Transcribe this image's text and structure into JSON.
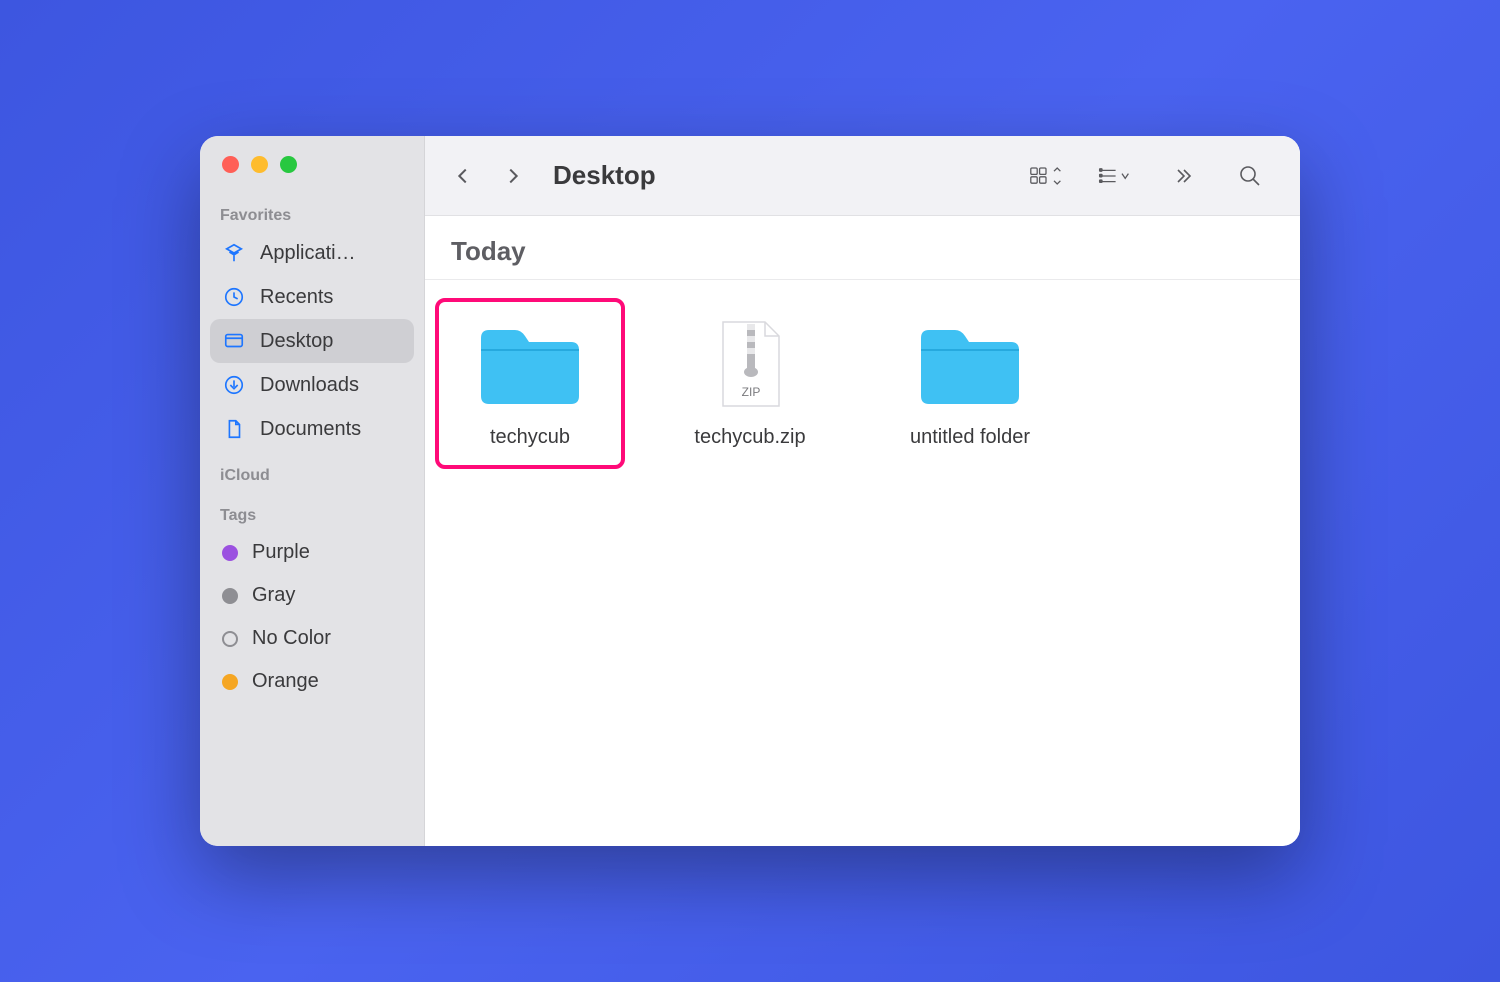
{
  "sidebar": {
    "groups": {
      "favorites": {
        "label": "Favorites",
        "items": [
          {
            "icon": "applications",
            "label": "Applicati…"
          },
          {
            "icon": "recents",
            "label": "Recents"
          },
          {
            "icon": "desktop",
            "label": "Desktop",
            "active": true
          },
          {
            "icon": "downloads",
            "label": "Downloads"
          },
          {
            "icon": "documents",
            "label": "Documents"
          }
        ]
      },
      "icloud": {
        "label": "iCloud"
      },
      "tags": {
        "label": "Tags",
        "items": [
          {
            "color": "purple",
            "label": "Purple"
          },
          {
            "color": "gray",
            "label": "Gray"
          },
          {
            "color": "nocolor",
            "label": "No Color"
          },
          {
            "color": "orange",
            "label": "Orange"
          }
        ]
      }
    }
  },
  "toolbar": {
    "title": "Desktop"
  },
  "section": {
    "heading": "Today"
  },
  "files": [
    {
      "type": "folder",
      "label": "techycub",
      "highlighted": true
    },
    {
      "type": "zip",
      "label": "techycub.zip",
      "highlighted": false
    },
    {
      "type": "folder",
      "label": "untitled folder",
      "highlighted": false
    }
  ]
}
